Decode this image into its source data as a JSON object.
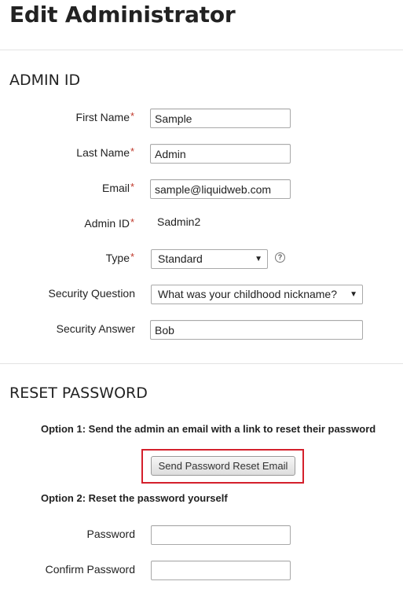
{
  "page": {
    "title": "Edit Administrator"
  },
  "admin_id_section": {
    "heading": "ADMIN ID",
    "required_marker": "*",
    "first_name": {
      "label": "First Name",
      "value": "Sample"
    },
    "last_name": {
      "label": "Last Name",
      "value": "Admin"
    },
    "email": {
      "label": "Email",
      "value": "sample@liquidweb.com"
    },
    "admin_id": {
      "label": "Admin ID",
      "value": "Sadmin2"
    },
    "type": {
      "label": "Type",
      "selected": "Standard",
      "help_icon": "question-circle-icon"
    },
    "security_question": {
      "label": "Security Question",
      "selected": "What was your childhood nickname?"
    },
    "security_answer": {
      "label": "Security Answer",
      "value": "Bob"
    }
  },
  "reset_password_section": {
    "heading": "RESET PASSWORD",
    "option1_text": "Option 1: Send the admin an email with a link to reset their password",
    "send_reset_button": "Send Password Reset Email",
    "highlight_color": "#d4202c",
    "option2_text": "Option 2: Reset the password yourself",
    "password": {
      "label": "Password",
      "value": ""
    },
    "confirm_password": {
      "label": "Confirm Password",
      "value": ""
    }
  }
}
